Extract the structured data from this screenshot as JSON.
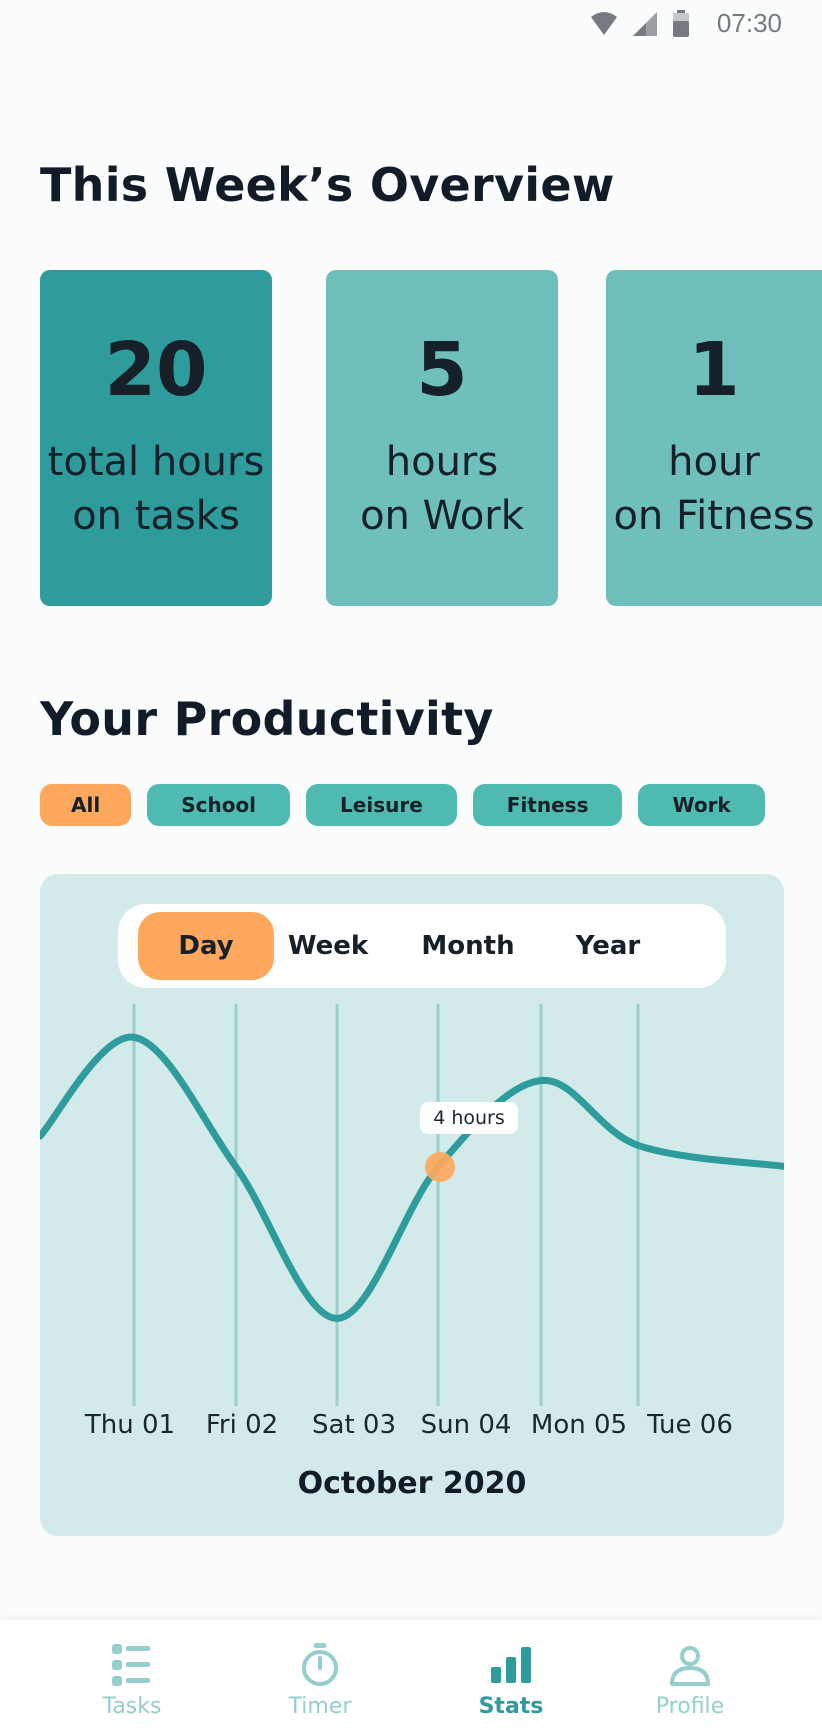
{
  "status_bar": {
    "time": "07:30",
    "icons": [
      "wifi-icon",
      "signal-icon",
      "battery-icon"
    ]
  },
  "overview": {
    "title": "This Week’s Overview",
    "cards": [
      {
        "number": "20",
        "label": "total hours\non tasks"
      },
      {
        "number": "5",
        "label": "hours\non Work"
      },
      {
        "number": "1",
        "label": "hour\non Fitness"
      }
    ]
  },
  "productivity": {
    "title": "Your Productivity",
    "filters": [
      "All",
      "School",
      "Leisure",
      "Fitness",
      "Work"
    ],
    "active_filter": "All",
    "ranges": [
      "Day",
      "Week",
      "Month",
      "Year"
    ],
    "active_range": "Day",
    "tooltip": "4 hours",
    "month_label": "October 2020"
  },
  "chart_data": {
    "type": "line",
    "x": [
      "Thu 01",
      "Fri 02",
      "Sat 03",
      "Sun 04",
      "Mon 05",
      "Tue 06"
    ],
    "series": [
      {
        "values": [
          7,
          4,
          0.5,
          4,
          6,
          4.5
        ]
      }
    ],
    "highlight": {
      "x": "Sun 04",
      "label": "4 hours"
    },
    "ylim": [
      0,
      8
    ],
    "grid": "vertical",
    "colors": {
      "line": "#2e9c9c",
      "highlight": "#fda85c",
      "background": "#d3eaea"
    }
  },
  "bottom_nav": {
    "items": [
      {
        "label": "Tasks",
        "icon": "tasks-icon"
      },
      {
        "label": "Timer",
        "icon": "timer-icon"
      },
      {
        "label": "Stats",
        "icon": "stats-icon"
      },
      {
        "label": "Profile",
        "icon": "profile-icon"
      }
    ],
    "active": "Stats"
  },
  "colors": {
    "accent": "#fda85c",
    "primary": "#2e9c9c",
    "primary_light": "#6fbfbd",
    "chip": "#4fbab2"
  }
}
